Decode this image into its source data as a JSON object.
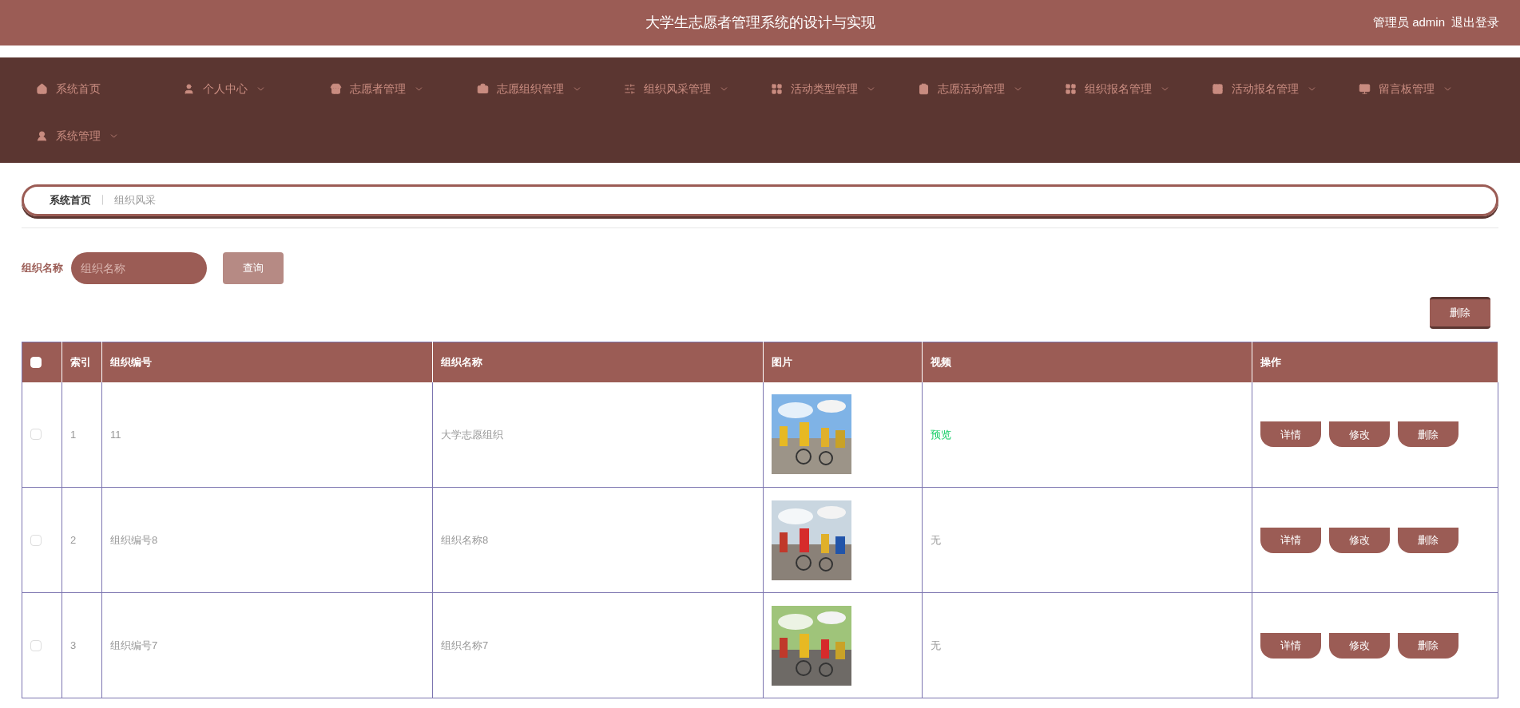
{
  "header": {
    "title": "大学生志愿者管理系统的设计与实现",
    "user": "管理员 admin",
    "logout": "退出登录"
  },
  "nav": [
    {
      "label": "系统首页",
      "expandable": false
    },
    {
      "label": "个人中心",
      "expandable": true
    },
    {
      "label": "志愿者管理",
      "expandable": true
    },
    {
      "label": "志愿组织管理",
      "expandable": true
    },
    {
      "label": "组织风采管理",
      "expandable": true
    },
    {
      "label": "活动类型管理",
      "expandable": true
    },
    {
      "label": "志愿活动管理",
      "expandable": true
    },
    {
      "label": "组织报名管理",
      "expandable": true
    },
    {
      "label": "活动报名管理",
      "expandable": true
    },
    {
      "label": "留言板管理",
      "expandable": true
    },
    {
      "label": "系统管理",
      "expandable": true
    }
  ],
  "breadcrumb": {
    "home": "系统首页",
    "separator": "〡",
    "current": "组织风采"
  },
  "search": {
    "label": "组织名称",
    "placeholder": "组织名称",
    "button": "查询"
  },
  "delete_button": "删除",
  "table": {
    "select_all_checked": false,
    "columns": [
      "索引",
      "组织编号",
      "组织名称",
      "图片",
      "视频",
      "操作"
    ],
    "rows": [
      {
        "checked": false,
        "index": "1",
        "code": "11",
        "name": "大学志愿组织",
        "video": {
          "kind": "link",
          "text": "预览"
        },
        "actions": [
          "详情",
          "修改",
          "删除"
        ]
      },
      {
        "checked": false,
        "index": "2",
        "code": "组织编号8",
        "name": "组织名称8",
        "video": {
          "kind": "text",
          "text": "无"
        },
        "actions": [
          "详情",
          "修改",
          "删除"
        ]
      },
      {
        "checked": false,
        "index": "3",
        "code": "组织编号7",
        "name": "组织名称7",
        "video": {
          "kind": "text",
          "text": "无"
        },
        "actions": [
          "详情",
          "修改",
          "删除"
        ]
      }
    ]
  }
}
